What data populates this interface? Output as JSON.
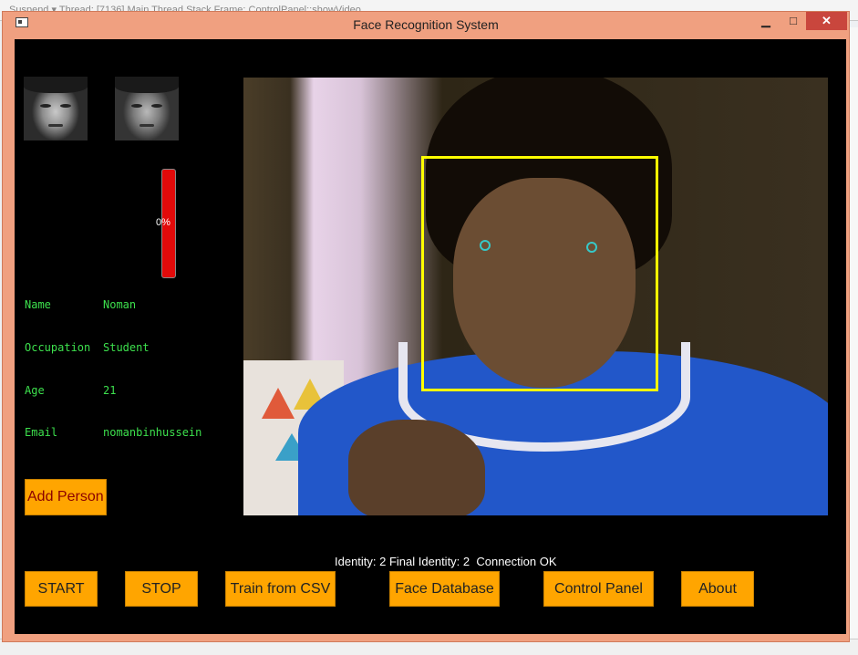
{
  "background_ide": {
    "toolbar_text": "Suspend  ▾  Thread: [7136] Main Thread          Stack Frame: ControlPanel::showVideo"
  },
  "window": {
    "title": "Face Recognition System",
    "minimize_glyph": "▁",
    "maximize_glyph": "□",
    "close_glyph": "✕"
  },
  "match_meter": {
    "percent_label": "0%",
    "level": 0
  },
  "person": {
    "fields": [
      {
        "label": "Name",
        "value": "Noman"
      },
      {
        "label": "Occupation",
        "value": "Student"
      },
      {
        "label": "Age",
        "value": "21"
      },
      {
        "label": "Email",
        "value": "nomanbinhussein"
      }
    ]
  },
  "buttons": {
    "add_person": "Add Person",
    "start": "START",
    "stop": "STOP",
    "train_csv": "Train from CSV",
    "face_database": "Face Database",
    "control_panel": "Control Panel",
    "about": "About"
  },
  "status": {
    "text": "Identity: 2 Final Identity: 2  Connection OK"
  },
  "colors": {
    "button_bg": "#ffa500",
    "info_text": "#3de04d",
    "face_box": "#ffff00",
    "eye_marker": "#36c8c8",
    "meter": "#e20a0a"
  }
}
